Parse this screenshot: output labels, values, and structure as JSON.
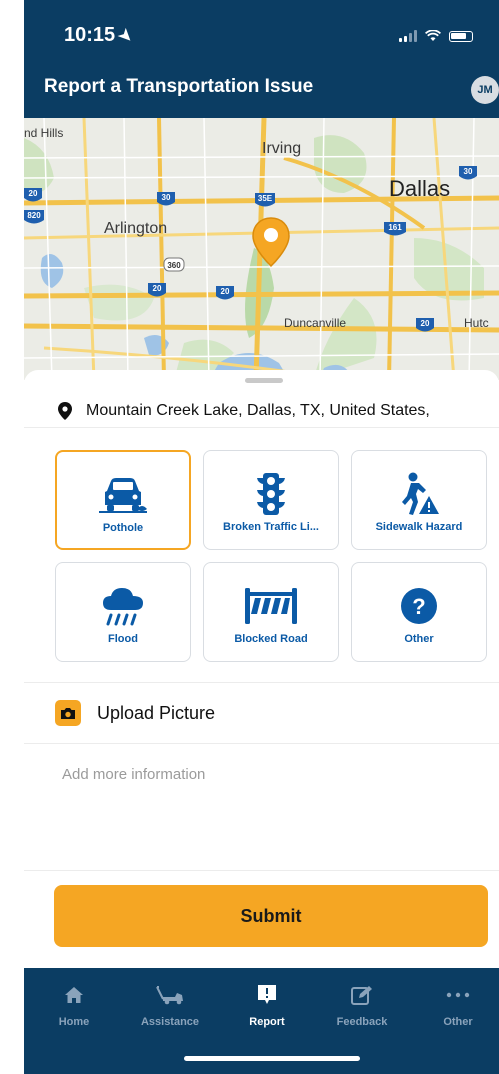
{
  "status_bar": {
    "time": "10:15"
  },
  "header": {
    "title": "Report a Transportation Issue",
    "avatar_initials": "JM"
  },
  "map": {
    "labels": {
      "hills": "nd Hills",
      "irving": "Irving",
      "dallas": "Dallas",
      "arlington": "Arlington",
      "duncanville": "Duncanville",
      "hutchins": "Hutc"
    },
    "shields": {
      "i20_a": "20",
      "i30_a": "30",
      "i35e": "35E",
      "i30_b": "30",
      "i360": "360",
      "i20_b": "20",
      "i20_c": "20",
      "i20_d": "20",
      "i820": "820",
      "i161": "161"
    },
    "pin_color": "#f5a623"
  },
  "sheet": {
    "location": "Mountain Creek Lake, Dallas, TX, United States,",
    "categories": [
      {
        "label": "Pothole",
        "icon": "car-pothole-icon"
      },
      {
        "label": "Broken Traffic Li...",
        "icon": "traffic-light-icon"
      },
      {
        "label": "Sidewalk Hazard",
        "icon": "pedestrian-hazard-icon"
      },
      {
        "label": "Flood",
        "icon": "rain-cloud-icon"
      },
      {
        "label": "Blocked Road",
        "icon": "barrier-icon"
      },
      {
        "label": "Other",
        "icon": "question-icon"
      }
    ],
    "upload_label": "Upload Picture",
    "more_info_placeholder": "Add more information",
    "submit_label": "Submit"
  },
  "tabbar": {
    "tabs": [
      {
        "label": "Home",
        "icon": "home-icon"
      },
      {
        "label": "Assistance",
        "icon": "tow-truck-icon"
      },
      {
        "label": "Report",
        "icon": "report-icon"
      },
      {
        "label": "Feedback",
        "icon": "edit-icon"
      },
      {
        "label": "Other",
        "icon": "more-icon"
      }
    ],
    "active": "Report"
  },
  "colors": {
    "navy": "#0b3d63",
    "accent": "#f5a623",
    "link_blue": "#0b5aa6"
  }
}
